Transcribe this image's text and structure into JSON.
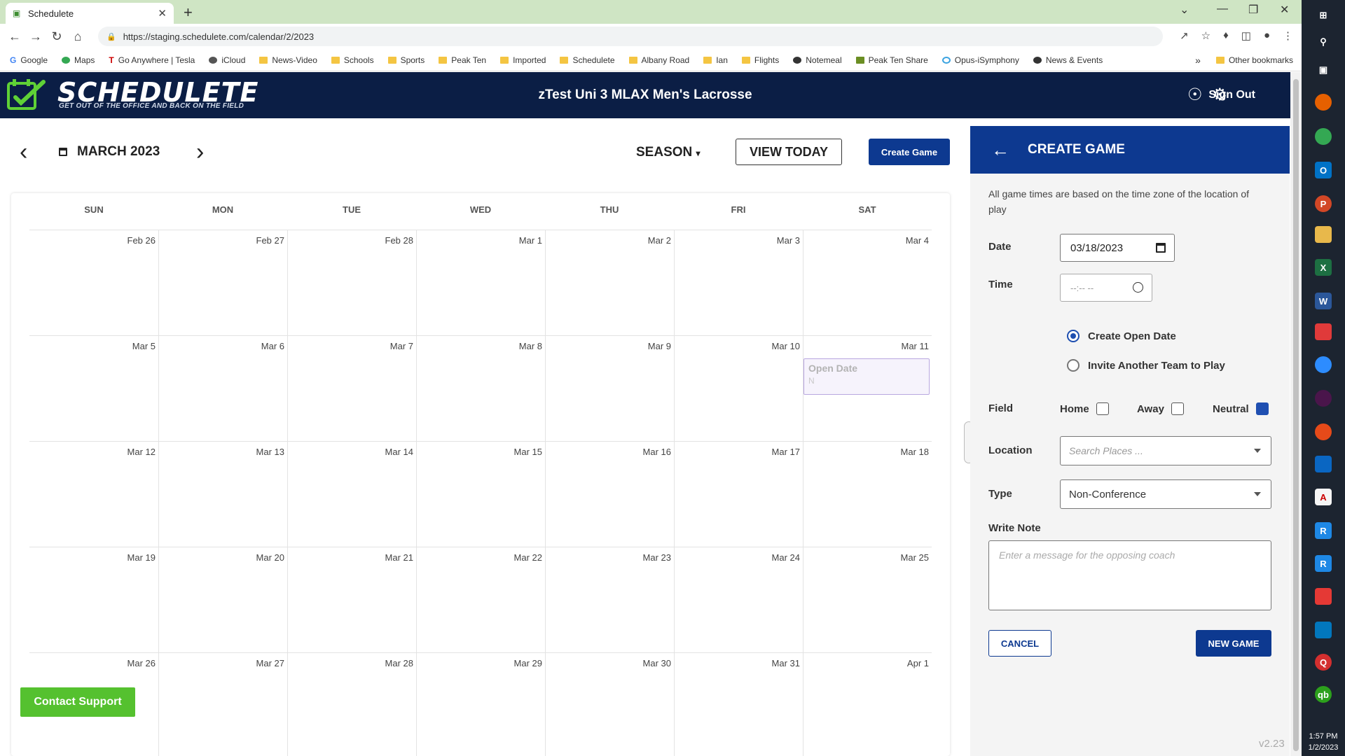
{
  "browser": {
    "tab_title": "Schedulete",
    "url": "https://staging.schedulete.com/calendar/2/2023",
    "bookmarks": [
      "Google",
      "Maps",
      "Go Anywhere | Tesla",
      "iCloud",
      "News-Video",
      "Schools",
      "Sports",
      "Peak Ten",
      "Imported",
      "Schedulete",
      "Albany Road",
      "Ian",
      "Flights",
      "Notemeal",
      "Peak Ten Share",
      "Opus-iSymphony",
      "News & Events"
    ],
    "other_bookmarks": "Other bookmarks"
  },
  "header": {
    "logo_text": "SCHEDULETE",
    "logo_tagline": "GET OUT OF THE OFFICE AND BACK ON THE FIELD",
    "team_title": "zTest Uni 3 MLAX Men's Lacrosse",
    "sign_out": "Sign Out"
  },
  "calendar": {
    "month_label": "MARCH 2023",
    "season_label": "SEASON",
    "view_today": "VIEW TODAY",
    "create_game": "Create Game",
    "weekdays": [
      "SUN",
      "MON",
      "TUE",
      "WED",
      "THU",
      "FRI",
      "SAT"
    ],
    "weeks": [
      [
        "Feb 26",
        "Feb 27",
        "Feb 28",
        "Mar 1",
        "Mar 2",
        "Mar 3",
        "Mar 4"
      ],
      [
        "Mar 5",
        "Mar 6",
        "Mar 7",
        "Mar 8",
        "Mar 9",
        "Mar 10",
        "Mar 11"
      ],
      [
        "Mar 12",
        "Mar 13",
        "Mar 14",
        "Mar 15",
        "Mar 16",
        "Mar 17",
        "Mar 18"
      ],
      [
        "Mar 19",
        "Mar 20",
        "Mar 21",
        "Mar 22",
        "Mar 23",
        "Mar 24",
        "Mar 25"
      ],
      [
        "Mar 26",
        "Mar 27",
        "Mar 28",
        "Mar 29",
        "Mar 30",
        "Mar 31",
        "Apr 1"
      ]
    ],
    "event": {
      "title": "Open Date",
      "subtitle": "N"
    },
    "contact_support": "Contact Support"
  },
  "panel": {
    "title": "CREATE GAME",
    "tz_note": "All game times are based on the time zone of the location of play",
    "date_label": "Date",
    "date_value": "03/18/2023",
    "time_label": "Time",
    "time_placeholder": "--:-- --",
    "option_open": "Create Open Date",
    "option_invite": "Invite Another Team to Play",
    "field_label": "Field",
    "field_home": "Home",
    "field_away": "Away",
    "field_neutral": "Neutral",
    "location_label": "Location",
    "location_placeholder": "Search Places ...",
    "type_label": "Type",
    "type_value": "Non-Conference",
    "note_label": "Write Note",
    "note_placeholder": "Enter a message for the opposing coach",
    "cancel": "CANCEL",
    "new_game": "NEW GAME",
    "version": "v2.23"
  },
  "taskbar": {
    "time": "1:57 PM",
    "date": "1/2/2023"
  },
  "colors": {
    "navy": "#0b1e45",
    "primary": "#0d3990",
    "support_green": "#55c12f"
  }
}
